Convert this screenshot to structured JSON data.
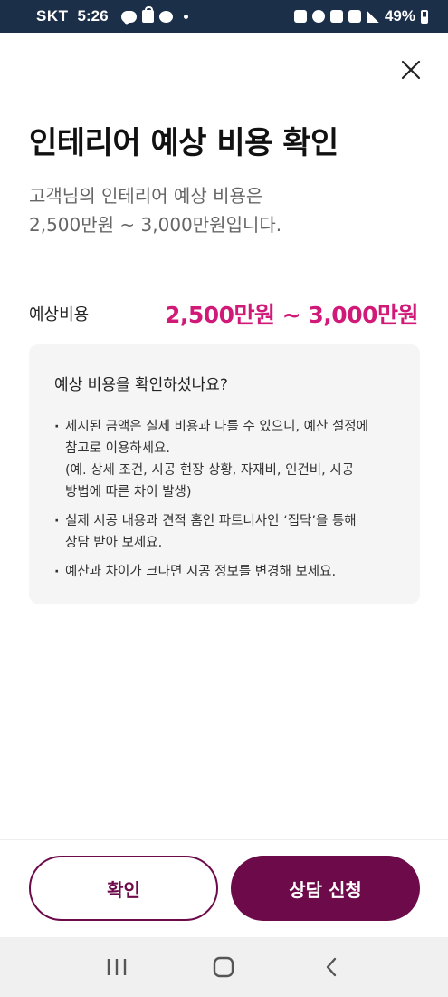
{
  "status_bar": {
    "carrier": "SKT",
    "time": "5:26",
    "battery": "49%",
    "icons": [
      "talk-icon",
      "bag-icon",
      "bubble-icon",
      "dot-icon",
      "lock-icon",
      "alarm-icon",
      "mute-icon",
      "5g-icon",
      "signal-icon",
      "battery-icon"
    ]
  },
  "header": {
    "close_icon": "close-icon",
    "title": "인테리어 예상 비용 확인",
    "subtitle_line1": "고객님의 인테리어 예상 비용은",
    "subtitle_line2": "2,500만원 ~ 3,000만원입니다."
  },
  "estimate": {
    "label": "예상비용",
    "value": "2,500만원 ~ 3,000만원"
  },
  "info": {
    "title": "예상 비용을 확인하셨나요?",
    "items": [
      {
        "line1": "제시된 금액은 실제 비용과 다를 수 있으니, 예산 설정에",
        "line2": "참고로 이용하세요.",
        "line3": "(예. 상세 조건, 시공 현장 상황, 자재비, 인건비, 시공",
        "line4": "방법에 따른 차이 발생)"
      },
      {
        "line1": "실제 시공 내용과 견적 홈인 파트너사인 ‘집닥’을 통해",
        "line2": "상담 받아 보세요."
      },
      {
        "line1": "예산과 차이가 크다면 시공 정보를 변경해 보세요."
      }
    ]
  },
  "actions": {
    "confirm_label": "확인",
    "consult_label": "상담 신청"
  },
  "nav": {
    "icons": [
      "recent-apps-icon",
      "home-icon",
      "back-icon"
    ]
  },
  "colors": {
    "accent": "#d11a78",
    "primary": "#6d0a4a",
    "status_bar": "#1b2f49"
  }
}
